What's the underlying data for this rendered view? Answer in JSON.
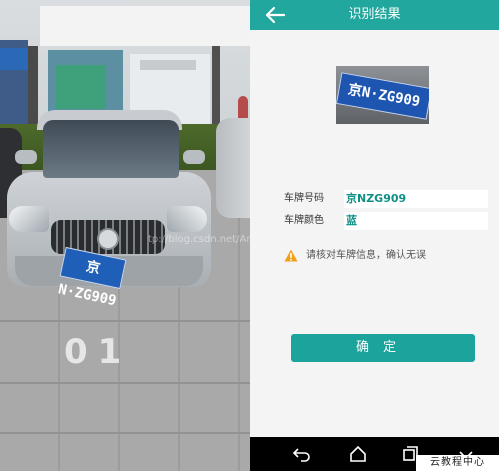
{
  "photo": {
    "plate_text": "京N·ZG909",
    "parking_number": "01",
    "url_watermark": "tp://blog.csdn.net/Amilia2017"
  },
  "app": {
    "title": "识别结果",
    "back_icon": "arrow-left-icon",
    "crop_plate_text": "京N·ZG909",
    "fields": {
      "plate_number_label": "车牌号码",
      "plate_number_value": "京NZG909",
      "plate_color_label": "车牌颜色",
      "plate_color_value": "蓝"
    },
    "warning_icon": "warning-triangle-icon",
    "warning_text": "请核对车牌信息，确认无误",
    "confirm_label": "确定",
    "accent_color": "#21a79d",
    "warning_color": "#f0a01a"
  },
  "navbar": {
    "icons": [
      "back-nav-icon",
      "home-nav-icon",
      "recent-apps-icon",
      "menu-down-icon"
    ]
  },
  "watermark": "云教程中心"
}
